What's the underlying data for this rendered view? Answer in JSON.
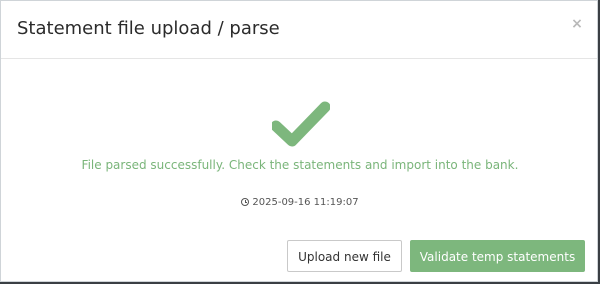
{
  "modal": {
    "title": "Statement file upload / parse",
    "close_label": "×"
  },
  "result": {
    "icon": "checkmark-icon",
    "message": "File parsed successfully. Check the statements and import into the bank.",
    "timestamp": "2025-09-16 11:19:07"
  },
  "actions": {
    "upload_new_label": "Upload new file",
    "validate_label": "Validate temp statements"
  },
  "colors": {
    "success": "#7db77d",
    "success_text": "#7ab57a",
    "title": "#2b2b2b",
    "close": "#b9b9b9"
  }
}
